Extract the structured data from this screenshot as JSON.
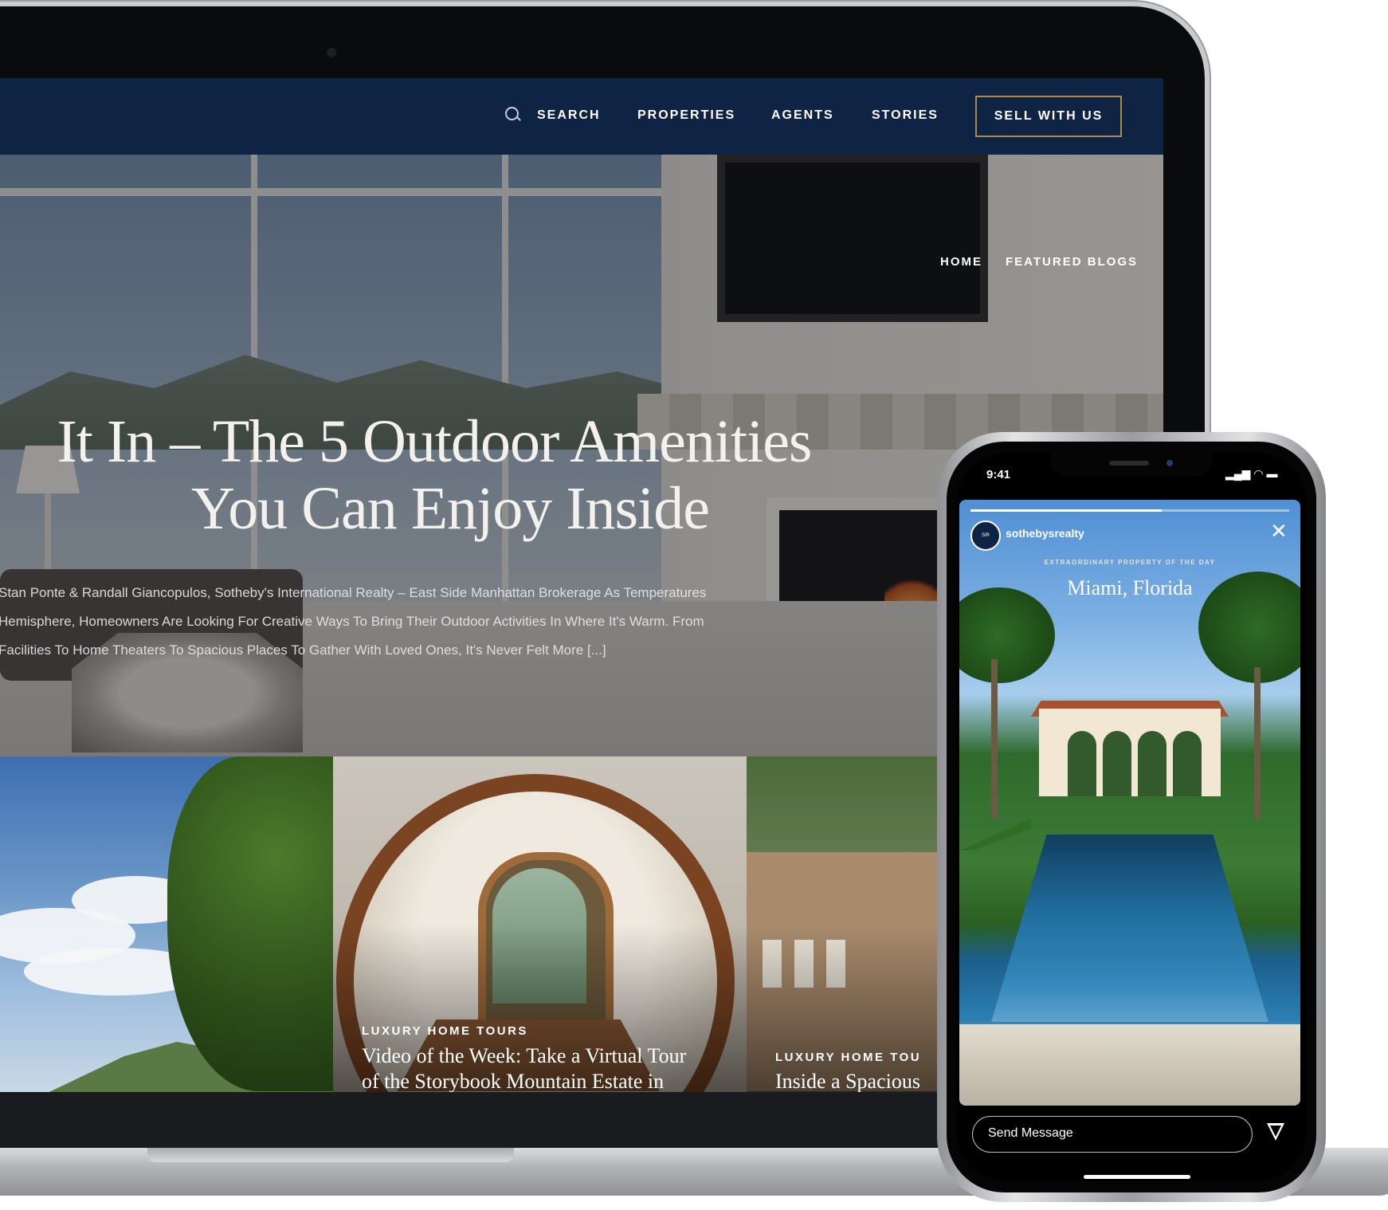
{
  "nav": {
    "search": "SEARCH",
    "properties": "PROPERTIES",
    "agents": "AGENTS",
    "stories": "STORIES",
    "sell": "SELL WITH US"
  },
  "breadcrumb": {
    "home": "HOME",
    "featured": "FEATURED BLOGS"
  },
  "hero": {
    "title_line1": "It In – The 5 Outdoor Amenities",
    "title_line2": "You Can Enjoy Inside",
    "excerpt_line1": "Stan Ponte & Randall Giancopulos, Sotheby's International Realty – East Side Manhattan Brokerage As Temperatures",
    "excerpt_line2": "Hemisphere, Homeowners Are Looking For Creative Ways To Bring Their Outdoor Activities In Where It's Warm. From",
    "excerpt_line3": "Facilities To Home Theaters To Spacious Places To Gather With Loved Ones, It's Never Felt More [...]"
  },
  "cards": [
    {
      "category": "",
      "title": ""
    },
    {
      "category": "LUXURY HOME TOURS",
      "title_line1": "Video of the Week: Take a Virtual Tour",
      "title_line2": "of the Storybook Mountain Estate in"
    },
    {
      "category": "LUXURY HOME TOU",
      "title_line1": "Inside a Spacious"
    }
  ],
  "phone": {
    "time": "9:41",
    "status_icons": "▂▄▆ ◠ ▬",
    "username": "sothebysrealty",
    "close": "✕",
    "kicker": "EXTRAORDINARY PROPERTY OF THE DAY",
    "location": "Miami, Florida",
    "message_placeholder": "Send Message",
    "story_progress": 0.6
  },
  "colors": {
    "navy": "#0f2344",
    "gold": "#a98b4b"
  },
  "icons": [
    "search-icon",
    "close-icon",
    "send-icon"
  ]
}
